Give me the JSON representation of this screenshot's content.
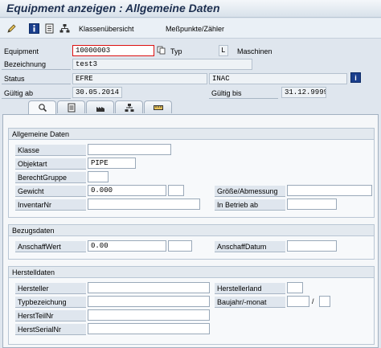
{
  "window": {
    "title": "Equipment anzeigen : Allgemeine Daten"
  },
  "toolbar": {
    "icons": [
      "edit-pencil-icon",
      "info-icon",
      "document-icon",
      "hierarchy-icon"
    ],
    "klassen_label": "Klassenübersicht",
    "messpunkte_label": "Meßpunkte/Zähler"
  },
  "header": {
    "equipment_label": "Equipment",
    "equipment_value": "10000003",
    "typ_label": "Typ",
    "typ_value": "L",
    "typ_desc": "Maschinen",
    "bezeichnung_label": "Bezeichnung",
    "bezeichnung_value": "test3",
    "status_label": "Status",
    "status_value": "EFRE",
    "status_value2": "INAC",
    "gueltig_ab_label": "Gültig ab",
    "gueltig_ab_value": "30.05.2014",
    "gueltig_bis_label": "Gültig bis",
    "gueltig_bis_value": "31.12.9999"
  },
  "tabs": [
    {
      "icon": "magnifier-icon",
      "active": true
    },
    {
      "icon": "document-icon",
      "active": false
    },
    {
      "icon": "factory-icon",
      "active": false
    },
    {
      "icon": "hierarchy-icon",
      "active": false
    },
    {
      "icon": "ruler-icon",
      "active": false
    }
  ],
  "allgemein": {
    "title": "Allgemeine Daten",
    "klasse_label": "Klasse",
    "klasse_value": "",
    "objektart_label": "Objektart",
    "objektart_value": "PIPE",
    "berecht_label": "BerechtGruppe",
    "berecht_value": "",
    "gewicht_label": "Gewicht",
    "gewicht_value": "0.000",
    "groesse_label": "Größe/Abmessung",
    "groesse_value": "",
    "inventar_label": "InventarNr",
    "inventar_value": "",
    "inbetrieb_label": "In Betrieb ab",
    "inbetrieb_value": ""
  },
  "bezug": {
    "title": "Bezugsdaten",
    "anschaffwert_label": "AnschaffWert",
    "anschaffwert_value": "0.00",
    "anschaffdatum_label": "AnschaffDatum",
    "anschaffdatum_value": ""
  },
  "hersteller": {
    "title": "Herstelldaten",
    "hersteller_label": "Hersteller",
    "herstellerland_label": "Herstellerland",
    "typbez_label": "Typbezeichung",
    "baujahr_label": "Baujahr/-monat",
    "baujahr_sep": "/",
    "teilnr_label": "HerstTeilNr",
    "serialnr_label": "HerstSerialNr"
  },
  "colors": {
    "background": "#dfe6ee",
    "title": "#1d2f50",
    "info_button": "#1a3e8c",
    "required_border": "#dd1111"
  }
}
